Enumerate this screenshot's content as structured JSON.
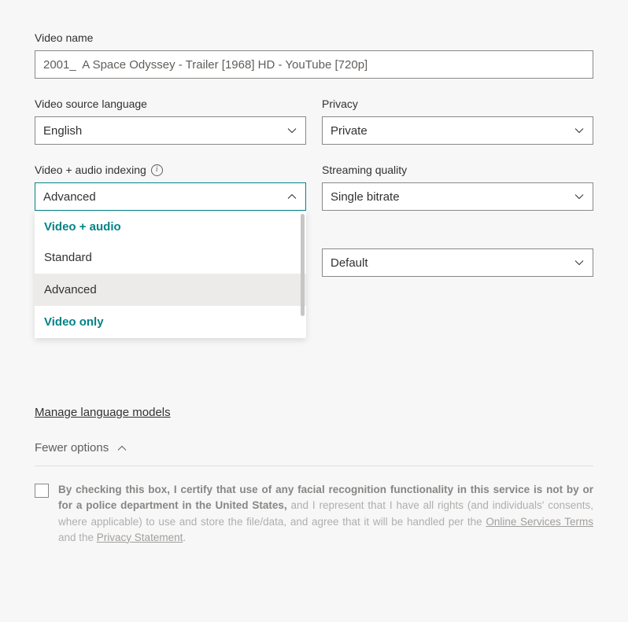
{
  "videoName": {
    "label": "Video name",
    "value": "2001_  A Space Odyssey - Trailer [1968] HD - YouTube [720p]"
  },
  "sourceLanguage": {
    "label": "Video source language",
    "value": "English"
  },
  "privacy": {
    "label": "Privacy",
    "value": "Private"
  },
  "indexing": {
    "label": "Video + audio indexing",
    "value": "Advanced",
    "options": {
      "group1": "Video + audio",
      "opt1": "Standard",
      "opt2": "Advanced",
      "group2": "Video only"
    }
  },
  "streamingQuality": {
    "label": "Streaming quality",
    "value": "Single bitrate"
  },
  "secondaryDefault": {
    "value": "Default"
  },
  "manageLink": "Manage language models",
  "toggleOptions": "Fewer options",
  "consent": {
    "bold": "By checking this box, I certify that use of any facial recognition functionality in this service is not by or for a police department in the United States,",
    "rest1": " and I represent that I have all rights (and individuals' consents, where applicable) to use and store the file/data, and agree that it will be handled per the ",
    "link1": "Online Services Terms",
    "mid": " and the ",
    "link2": "Privacy Statement",
    "end": "."
  }
}
